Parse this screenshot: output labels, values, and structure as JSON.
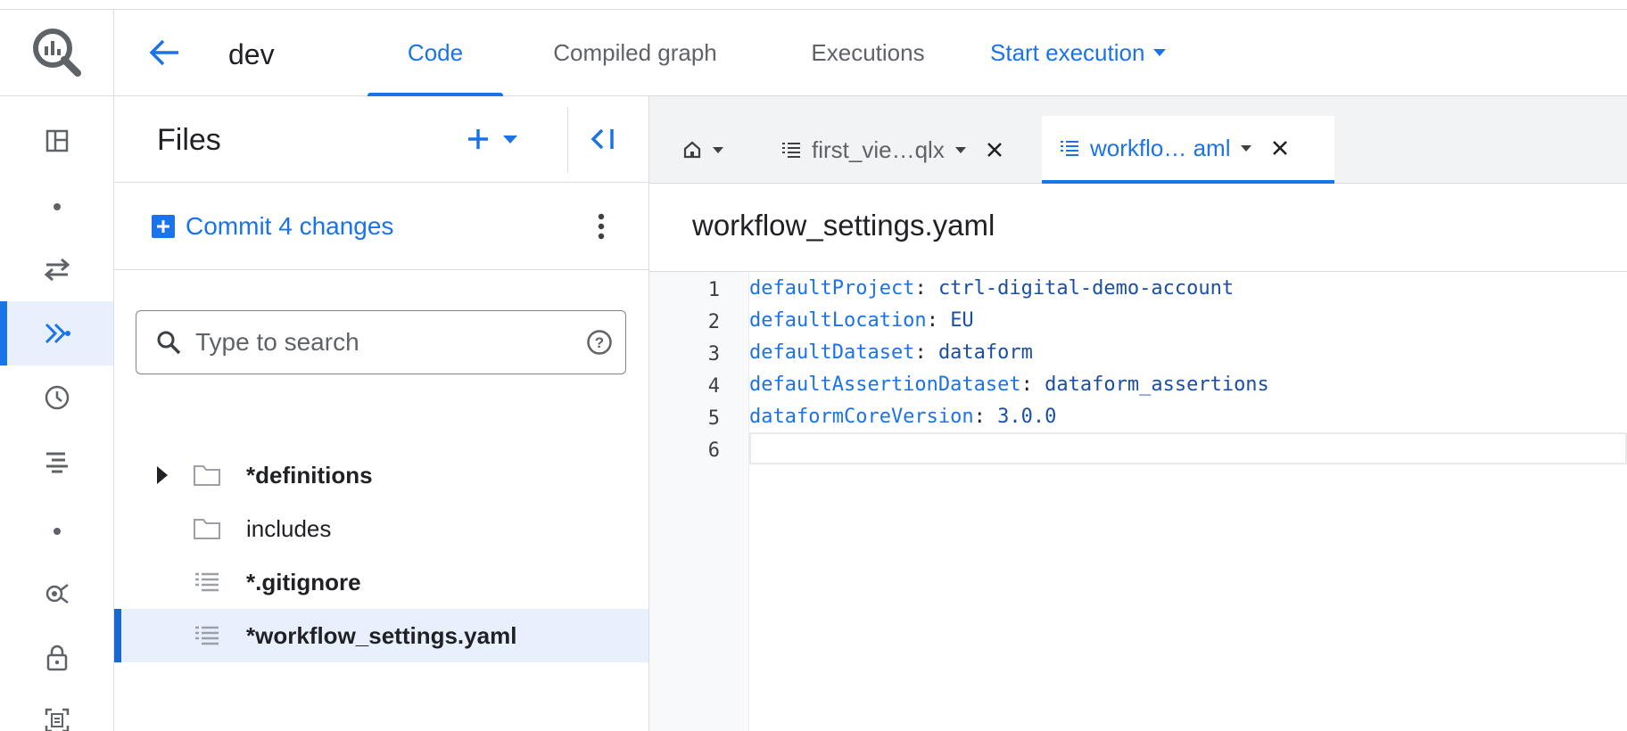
{
  "header": {
    "workspace_name": "dev",
    "tabs": [
      {
        "label": "Code",
        "active": true
      },
      {
        "label": "Compiled graph",
        "active": false
      },
      {
        "label": "Executions",
        "active": false
      }
    ],
    "start_execution_label": "Start execution"
  },
  "rail": {
    "items": [
      "dashboard-icon",
      "transfers-icon",
      "dataform-icon",
      "history-icon",
      "scheduled-queries-icon",
      "analytics-hub-icon",
      "policy-lock-icon",
      "document-scan-icon"
    ],
    "active": "dataform-icon"
  },
  "files_panel": {
    "title": "Files",
    "commit_label": "Commit 4 changes",
    "search_placeholder": "Type to search",
    "tree": [
      {
        "label": "*definitions",
        "type": "folder",
        "expandable": true,
        "bold": true,
        "selected": false
      },
      {
        "label": "includes",
        "type": "folder",
        "expandable": false,
        "bold": false,
        "selected": false
      },
      {
        "label": "*.gitignore",
        "type": "file",
        "expandable": false,
        "bold": true,
        "selected": false
      },
      {
        "label": "*workflow_settings.yaml",
        "type": "file",
        "expandable": false,
        "bold": true,
        "selected": true
      }
    ]
  },
  "editor": {
    "tabs": [
      {
        "label": "",
        "icon": "home-icon",
        "active": false
      },
      {
        "label": "first_vie…qlx",
        "icon": "file-list-icon",
        "active": false
      },
      {
        "label": "workflo… aml",
        "icon": "file-list-icon",
        "active": true
      }
    ],
    "file_title": "workflow_settings.yaml",
    "lines": [
      {
        "num": "1",
        "key": "defaultProject",
        "value": "ctrl-digital-demo-account"
      },
      {
        "num": "2",
        "key": "defaultLocation",
        "value": "EU"
      },
      {
        "num": "3",
        "key": "defaultDataset",
        "value": "dataform"
      },
      {
        "num": "4",
        "key": "defaultAssertionDataset",
        "value": "dataform_assertions"
      },
      {
        "num": "5",
        "key": "dataformCoreVersion",
        "value": "3.0.0"
      },
      {
        "num": "6",
        "key": "",
        "value": ""
      }
    ],
    "current_line": 6
  },
  "colors": {
    "accent": "#1a73e8",
    "selected_bg": "#e8f0fe",
    "border": "#dadce0"
  }
}
